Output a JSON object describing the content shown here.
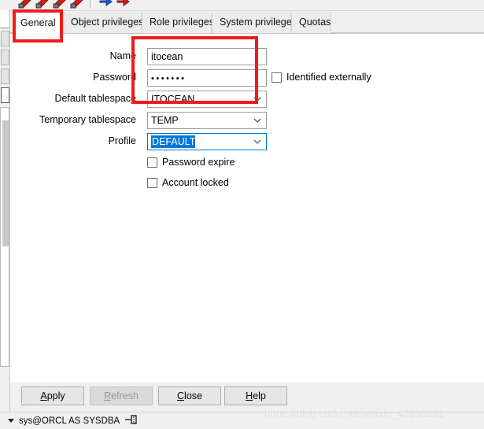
{
  "toolbar": {
    "icons": [
      {
        "name": "commit-red-icon",
        "color": "#d02020"
      },
      {
        "name": "rollback-red-icon",
        "color": "#d02020"
      },
      {
        "name": "delete-red-icon",
        "color": "#d02020"
      },
      {
        "name": "stop-red-icon",
        "color": "#d02020"
      },
      {
        "name": "previous-blue-arrow-icon",
        "color": "#1b5fd6"
      },
      {
        "name": "next-red-arrow-icon",
        "color": "#d02020"
      }
    ]
  },
  "tabs": [
    {
      "label": "General",
      "active": true
    },
    {
      "label": "Object privileges",
      "active": false
    },
    {
      "label": "Role privileges",
      "active": false
    },
    {
      "label": "System privileges",
      "active": false
    },
    {
      "label": "Quotas",
      "active": false
    }
  ],
  "form": {
    "fields": [
      {
        "label": "Name",
        "type": "text",
        "value": "itocean",
        "focused": false
      },
      {
        "label": "Password",
        "type": "password",
        "value": "•••••••",
        "focused": false
      },
      {
        "label": "Default tablespace",
        "type": "select",
        "value": "ITOCEAN",
        "focused": false
      },
      {
        "label": "Temporary tablespace",
        "type": "select",
        "value": "TEMP",
        "focused": false
      },
      {
        "label": "Profile",
        "type": "select",
        "value": "DEFAULT",
        "focused": true,
        "selected": true
      }
    ],
    "side_checkbox": {
      "label": "Identified externally",
      "checked": false
    },
    "checkboxes": [
      {
        "label": "Password expire",
        "checked": false
      },
      {
        "label": "Account locked",
        "checked": false
      }
    ]
  },
  "buttons": [
    {
      "label": "Apply",
      "accel": "A",
      "disabled": false
    },
    {
      "label": "Refresh",
      "accel": "R",
      "disabled": true
    },
    {
      "label": "Close",
      "accel": "C",
      "disabled": false
    },
    {
      "label": "Help",
      "accel": "H",
      "disabled": false
    }
  ],
  "statusbar": {
    "connection": "sys@ORCL AS SYSDBA",
    "pin_icon": "connection-pin-icon"
  },
  "watermark": {
    "text": "https://blog.csdn.net/weixin_42330251"
  },
  "annotations": {
    "accent_color": "#f21b1b",
    "boxes": [
      {
        "name": "general-tab-highlight"
      },
      {
        "name": "credentials-fields-highlight"
      }
    ]
  }
}
